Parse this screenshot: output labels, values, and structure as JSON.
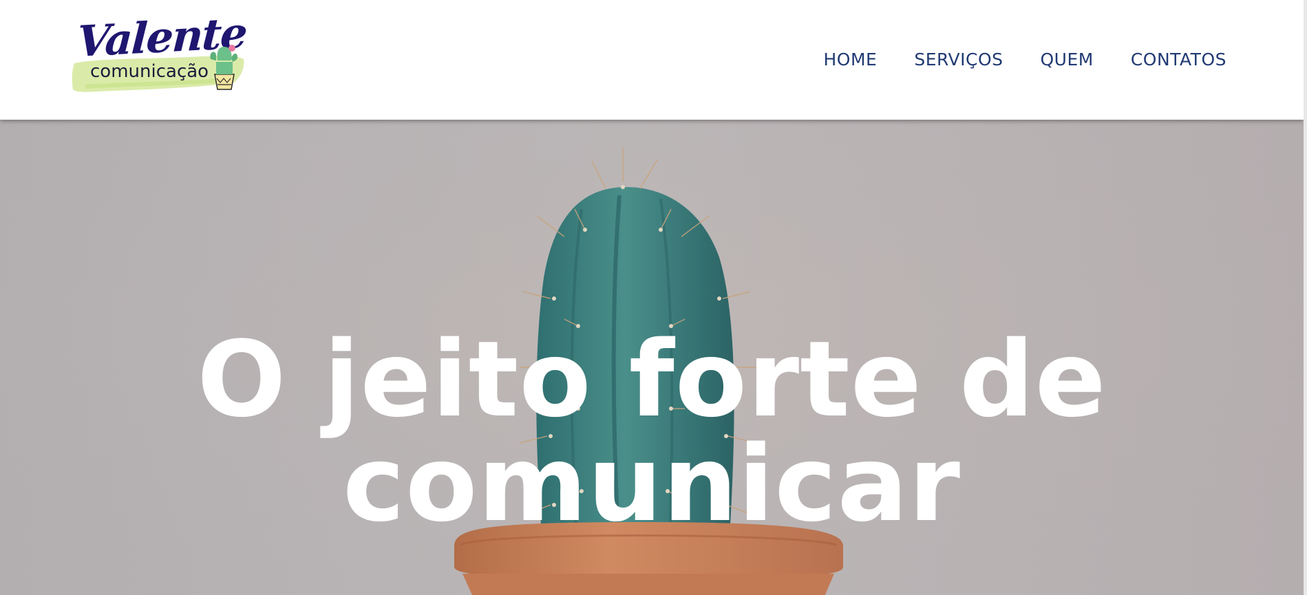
{
  "logo": {
    "title": "Valente",
    "subtitle": "comunicação",
    "icon": "cactus-pot-icon"
  },
  "nav": {
    "items": [
      {
        "label": "HOME"
      },
      {
        "label": "SERVIÇOS"
      },
      {
        "label": "QUEM"
      },
      {
        "label": "CONTATOS"
      }
    ]
  },
  "hero": {
    "headline_line1": "O jeito forte de",
    "headline_line2": "comunicar",
    "image": "cactus-in-pot-photo"
  },
  "colors": {
    "nav_text": "#213a73",
    "logo_text": "#1f1670",
    "headline": "#ffffff",
    "logo_brush": "#d6e9a0",
    "hero_bg": "#b9b4b5",
    "cactus": "#3a7f7a",
    "pot": "#c9825a"
  }
}
